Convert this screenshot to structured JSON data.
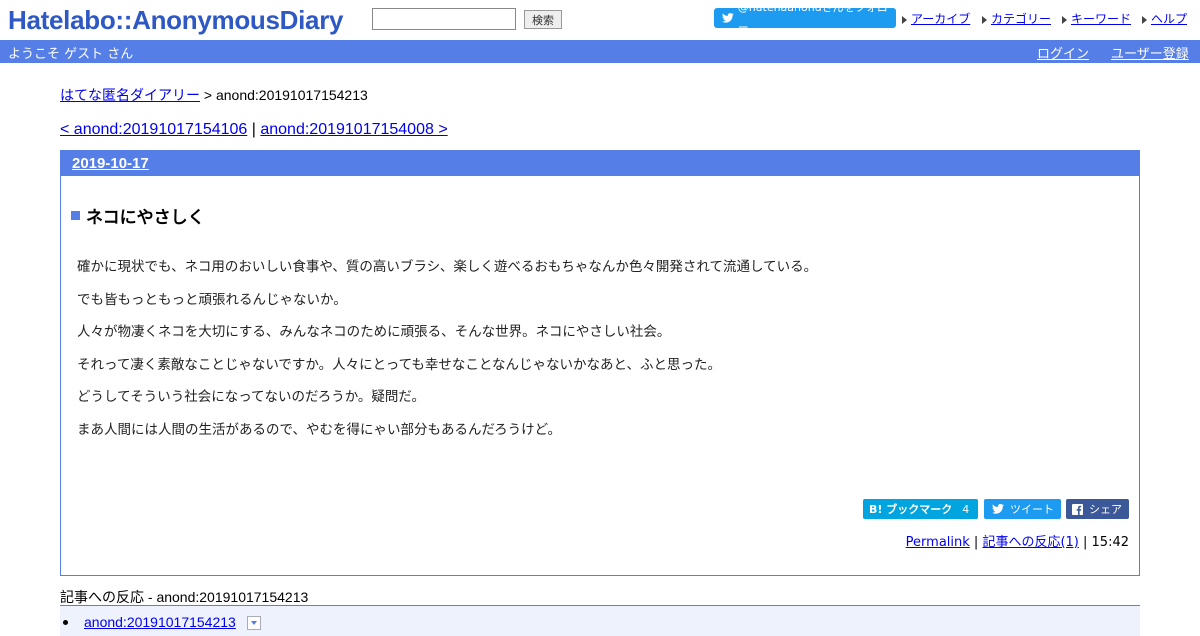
{
  "header": {
    "logo": "Hatelabo::AnonymousDiary",
    "search_value": "",
    "search_button": "検索",
    "follow_button": "@hatenaanondさんをフォロー",
    "links": [
      "アーカイブ",
      "カテゴリー",
      "キーワード",
      "ヘルプ"
    ]
  },
  "subbar": {
    "welcome": "ようこそ ゲスト さん",
    "login": "ログイン",
    "register": "ユーザー登録"
  },
  "breadcrumb": {
    "home": "はてな匿名ダイアリー",
    "separator": " > ",
    "current": "anond:20191017154213"
  },
  "pager": {
    "prev": "< anond:20191017154106",
    "separator": " | ",
    "next": "anond:20191017154008 >"
  },
  "day": {
    "date": "2019-10-17",
    "title": "ネコにやさしく",
    "body": [
      "確かに現状でも、ネコ用のおいしい食事や、質の高いブラシ、楽しく遊べるおもちゃなんか色々開発されて流通している。",
      "でも皆もっともっと頑張れるんじゃないか。",
      "人々が物凄くネコを大切にする、みんなネコのために頑張る、そんな世界。ネコにやさしい社会。",
      "それって凄く素敵なことじゃないですか。人々にとっても幸せなことなんじゃないかなあと、ふと思った。",
      "どうしてそういう社会になってないのだろうか。疑問だ。",
      "まあ人間には人間の生活があるので、やむを得にゃい部分もあるんだろうけど。"
    ],
    "share": {
      "hatena": "B! ブックマーク",
      "hatena_count": "4",
      "tweet": "ツイート",
      "facebook": "シェア"
    },
    "footer": {
      "permalink": "Permalink",
      "sep1": " | ",
      "reactions": "記事への反応(1)",
      "sep2": " | ",
      "time": "15:42"
    }
  },
  "reactions": {
    "title": "記事への反応 - anond:20191017154213",
    "items": [
      "anond:20191017154213"
    ]
  },
  "colors": {
    "brand": "#557ee6",
    "twitter": "#1d9bf0",
    "hatena": "#00a4de",
    "facebook": "#3b5998"
  }
}
